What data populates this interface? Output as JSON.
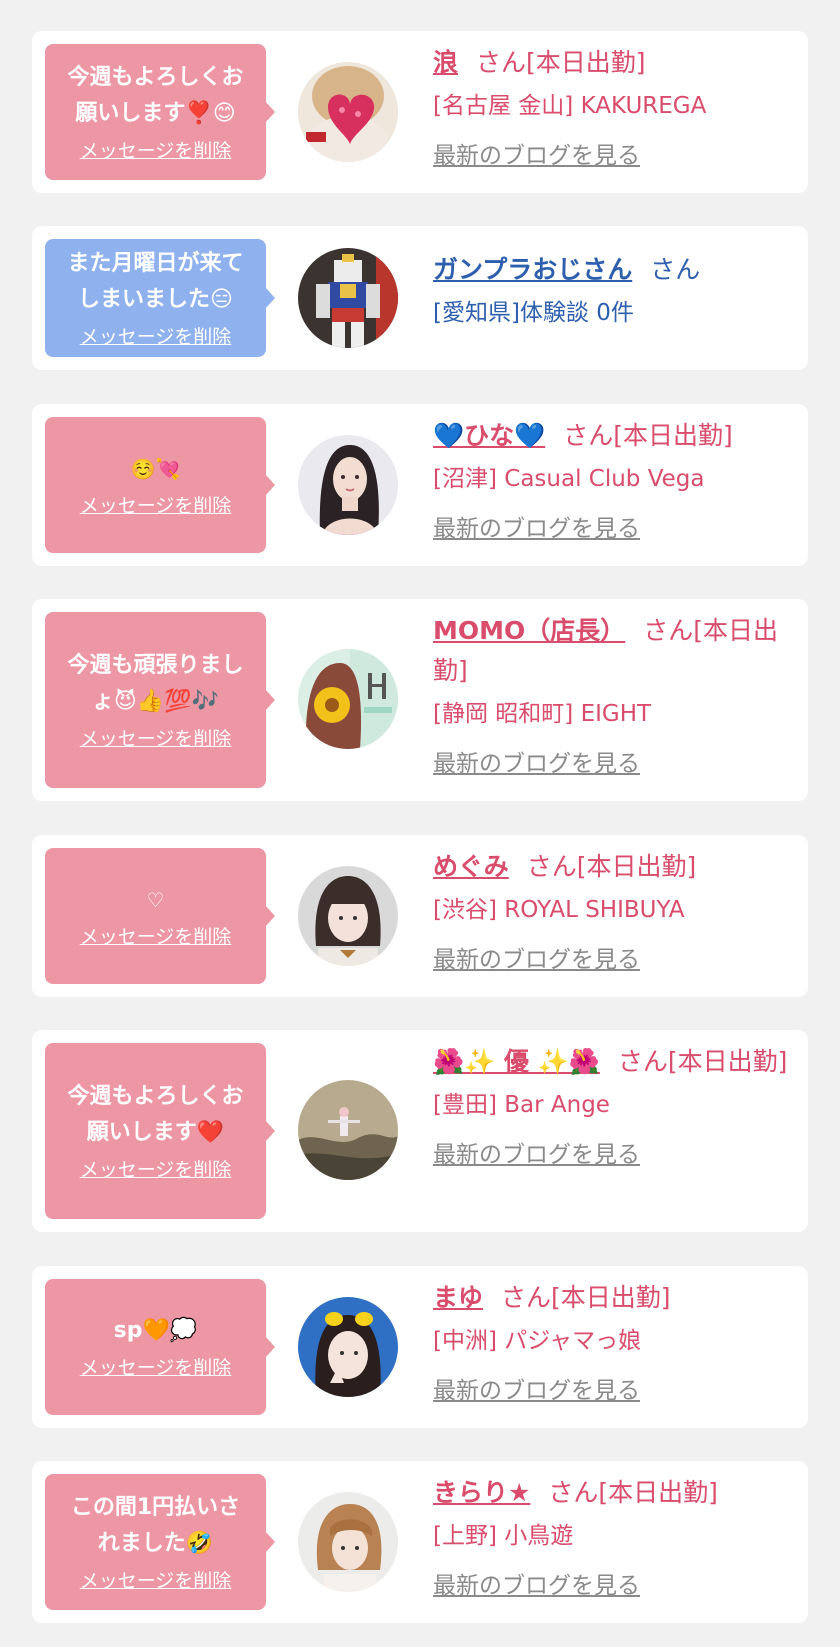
{
  "delete_label": "メッセージを削除",
  "blog_label": "最新のブログを見る",
  "entries": [
    {
      "message": "今週もよろしくお\n願いします❣️😊",
      "name": "浪",
      "suffix": "さん[本日出勤]",
      "shop": "[名古屋 金山] KAKUREGA",
      "has_blog": true,
      "avatar": "heart-sticker-photo"
    },
    {
      "message": "また月曜日が来て\nしまいました😑",
      "name": "ガンプラおじさん",
      "suffix": "さん",
      "shop": "[愛知県]体験談 0件",
      "has_blog": false,
      "avatar": "gundam-figure-photo"
    },
    {
      "message": "☺️💘",
      "name": "💙ひな💙",
      "suffix": "さん[本日出勤]",
      "shop": "[沼津] Casual Club Vega",
      "has_blog": true,
      "avatar": "woman-portrait-photo"
    },
    {
      "message": "今週も頑張りまし\nょ😈👍💯🎶",
      "name": "MOMO（店長）",
      "suffix": "さん[本日出勤]",
      "shop": "[静岡 昭和町] EIGHT",
      "has_blog": true,
      "avatar": "sunflower-eight-logo-photo"
    },
    {
      "message": "♡",
      "name": "めぐみ",
      "suffix": "さん[本日出勤]",
      "shop": "[渋谷] ROYAL SHIBUYA",
      "has_blog": true,
      "avatar": "bob-hair-girl-photo"
    },
    {
      "message": "今週もよろしくお\n願いします❤️",
      "name": "🌺✨ 優 ✨🌺",
      "suffix": "さん[本日出勤]",
      "shop": "[豊田] Bar Ange",
      "has_blog": true,
      "avatar": "cliff-landscape-photo"
    },
    {
      "message": "sp🧡💭",
      "name": "まゆ",
      "suffix": "さん[本日出勤]",
      "shop": "[中洲] パジャマっ娘",
      "has_blog": true,
      "avatar": "duck-hairclip-girl-photo"
    },
    {
      "message": "この間1円払いさ\nれました🤣",
      "name": "きらり★",
      "suffix": "さん[本日出勤]",
      "shop": "[上野] 小鳥遊",
      "has_blog": true,
      "avatar": "short-hair-girl-photo"
    }
  ]
}
